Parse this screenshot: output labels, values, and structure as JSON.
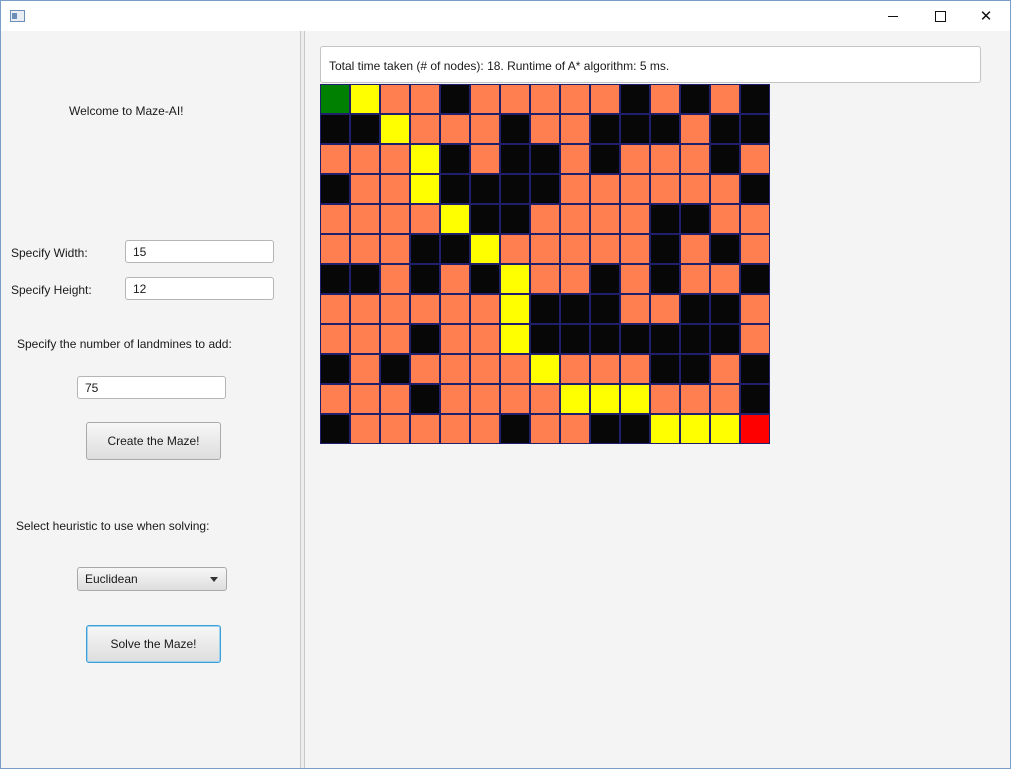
{
  "window": {
    "controls": {
      "minimize": "–",
      "maximize": "□",
      "close": "✕"
    }
  },
  "left_panel": {
    "welcome": "Welcome to Maze-AI!",
    "width_label": "Specify Width:",
    "width_value": "15",
    "height_label": "Specify Height:",
    "height_value": "12",
    "landmines_label": "Specify the number of landmines to add:",
    "landmines_value": "75",
    "create_button": "Create the Maze!",
    "heuristic_label": "Select heuristic to use when solving:",
    "heuristic_selected": "Euclidean",
    "solve_button": "Solve the Maze!"
  },
  "result": {
    "status_text": "Total time taken (# of nodes): 18.  Runtime of A* algorithm: 5 ms."
  },
  "maze": {
    "columns": 15,
    "rows_count": 12,
    "legend": {
      "B": "wall",
      "O": "free",
      "Y": "path",
      "G": "start",
      "R": "end"
    },
    "colors": {
      "wall": "#070707",
      "free": "#ff7f50",
      "path": "#ffff00",
      "start": "#008000",
      "end": "#ff0000",
      "grid_line": "#1f1f6b"
    },
    "rows": [
      "GYOOBOOOOOBOBOB",
      "BBYOOOBOOBBBOBB",
      "OOOYBOBBOBOOOBO",
      "BOOYBBBBOOOOOOB",
      "OOOOYBBOOOOBBOO",
      "OOOBBYOOOOOBOBO",
      "BBOBOBYOOBOBOOB",
      "OOOOOOYBBBOOBBO",
      "OOOBOOYBBBBBBBO",
      "BOBOOOOYOOOBBOB",
      "OOOBOOOOYYYOOOB",
      "BOOOOOBOOBBYYYR"
    ]
  }
}
